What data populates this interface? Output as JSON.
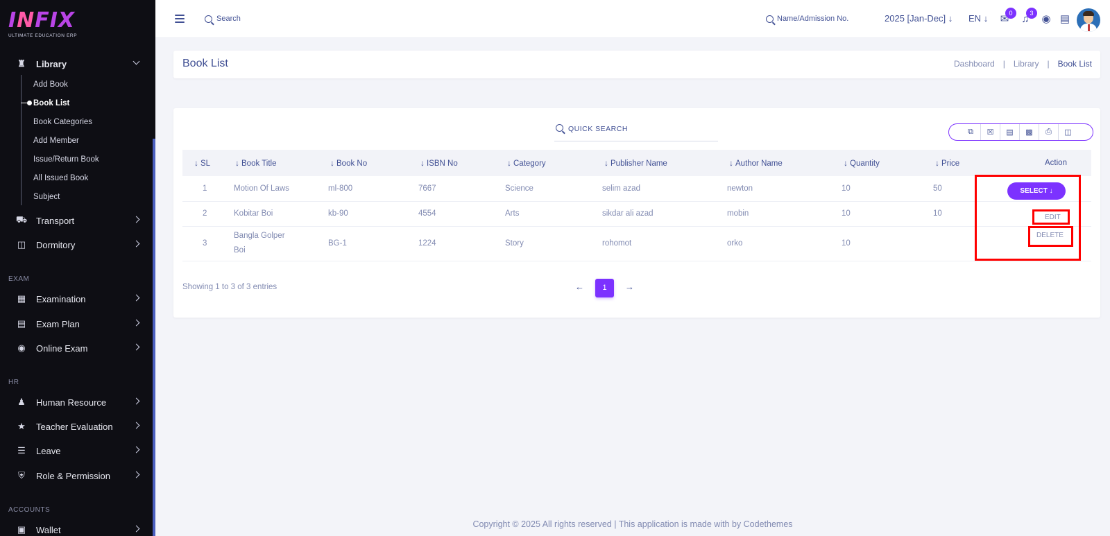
{
  "logo": {
    "text_main": "INFIX",
    "subtitle": "ULTIMATE EDUCATION ERP"
  },
  "sidebar": {
    "library": {
      "label": "Library",
      "icon": "library-icon"
    },
    "library_sub": [
      {
        "label": "Add Book"
      },
      {
        "label": "Book List",
        "active": true
      },
      {
        "label": "Book Categories"
      },
      {
        "label": "Add Member"
      },
      {
        "label": "Issue/Return Book"
      },
      {
        "label": "All Issued Book"
      },
      {
        "label": "Subject"
      }
    ],
    "transport": "Transport",
    "dormitory": "Dormitory",
    "section_exam": "EXAM",
    "examination": "Examination",
    "exam_plan": "Exam Plan",
    "online_exam": "Online Exam",
    "section_hr": "HR",
    "human_resource": "Human Resource",
    "teacher_evaluation": "Teacher Evaluation",
    "leave": "Leave",
    "role_permission": "Role & Permission",
    "section_accounts": "ACCOUNTS",
    "wallet": "Wallet"
  },
  "topbar": {
    "search_label": "Search",
    "admission_search": "Name/Admission No.",
    "year": "2025 [Jan-Dec]",
    "language": "EN",
    "messages_count": "0",
    "notifications_count": "3"
  },
  "page": {
    "title": "Book List",
    "breadcrumb": [
      "Dashboard",
      "Library",
      "Book List"
    ]
  },
  "table": {
    "quick_search_placeholder": "QUICK SEARCH",
    "columns": [
      "SL",
      "Book Title",
      "Book No",
      "ISBN No",
      "Category",
      "Publisher Name",
      "Author Name",
      "Quantity",
      "Price",
      "Action"
    ],
    "rows": [
      {
        "sl": "1",
        "title": "Motion Of Laws",
        "book_no": "ml-800",
        "isbn": "7667",
        "category": "Science",
        "publisher": "selim azad",
        "author": "newton",
        "quantity": "10",
        "price": "50"
      },
      {
        "sl": "2",
        "title": "Kobitar Boi",
        "book_no": "kb-90",
        "isbn": "4554",
        "category": "Arts",
        "publisher": "sikdar ali azad",
        "author": "mobin",
        "quantity": "10",
        "price": "10"
      },
      {
        "sl": "3",
        "title": "Bangla Golper Boi",
        "book_no": "BG-1",
        "isbn": "1224",
        "category": "Story",
        "publisher": "rohomot",
        "author": "orko",
        "quantity": "10",
        "price": ""
      }
    ],
    "select_label": "SELECT ↓",
    "edit_label": "EDIT",
    "delete_label": "DELETE",
    "showing_text": "Showing 1 to 3 of 3 entries",
    "current_page": "1"
  },
  "footer": "Copyright © 2025 All rights reserved | This application is made with by Codethemes",
  "colors": {
    "accent": "#7c32ff",
    "text": "#415094",
    "muted": "#828bb2",
    "sidebar_bg": "#0e0e14",
    "highlight": "#ff0000"
  }
}
